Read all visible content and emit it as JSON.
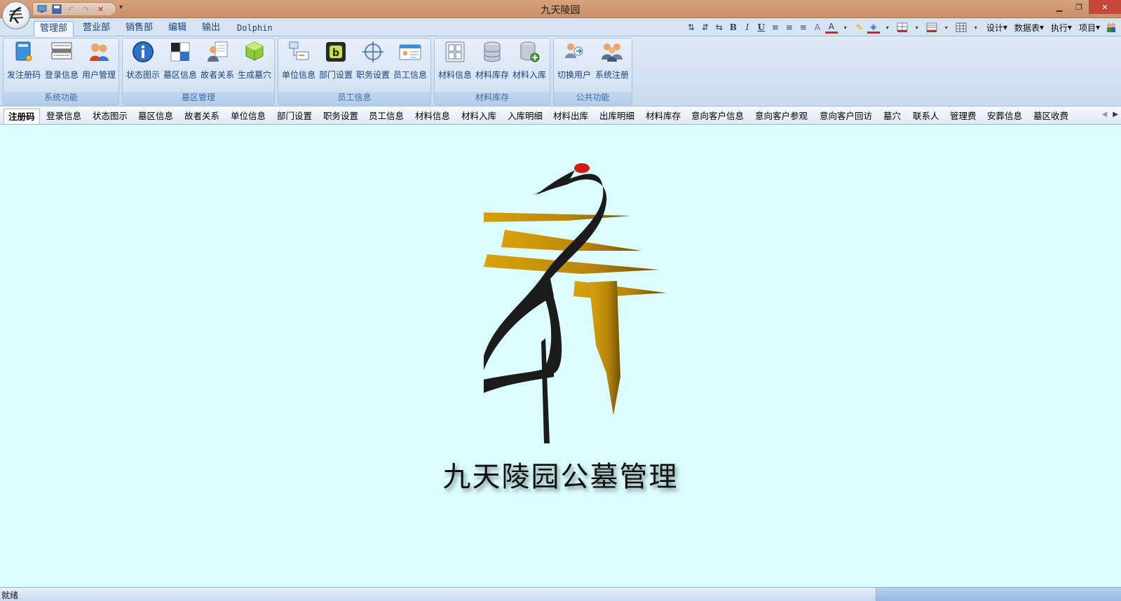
{
  "window": {
    "title": "九天陵园"
  },
  "ribbon_tabs": [
    "管理部",
    "营业部",
    "销售部",
    "编辑",
    "输出",
    "Dolphin"
  ],
  "format_toolbar": {
    "menus": [
      "设计",
      "数据表",
      "执行",
      "项目"
    ]
  },
  "ribbon_groups": [
    {
      "label": "系统功能",
      "buttons": [
        "发注册码",
        "登录信息",
        "用户管理"
      ]
    },
    {
      "label": "墓区管理",
      "buttons": [
        "状态图示",
        "墓区信息",
        "故者关系",
        "生成墓穴"
      ]
    },
    {
      "label": "员工信息",
      "buttons": [
        "单位信息",
        "部门设置",
        "职务设置",
        "员工信息"
      ]
    },
    {
      "label": "材料库存",
      "buttons": [
        "材料信息",
        "材料库存",
        "材料入库"
      ]
    },
    {
      "label": "公共功能",
      "buttons": [
        "切换用户",
        "系统注册"
      ]
    }
  ],
  "doc_tabs": [
    "注册码",
    "登录信息",
    "状态图示",
    "墓区信息",
    "故者关系",
    "单位信息",
    "部门设置",
    "职务设置",
    "员工信息",
    "材料信息",
    "材料入库",
    "入库明细",
    "材料出库",
    "出库明细",
    "材料库存",
    "意向客户信息",
    "意向客户参观",
    "意向客户回访",
    "墓穴",
    "联系人",
    "管理费",
    "安葬信息",
    "墓区收费"
  ],
  "splash": {
    "title": "九天陵园公墓管理"
  },
  "status": {
    "text": "就绪"
  },
  "colors": {
    "title_bar": "#c8906b",
    "content_bg": "#dcfdfd",
    "ribbon_bg": "#d7e5f4",
    "logo_gold": "#c79a16",
    "logo_black": "#1b1b1b",
    "crane_red": "#d21c1c"
  }
}
